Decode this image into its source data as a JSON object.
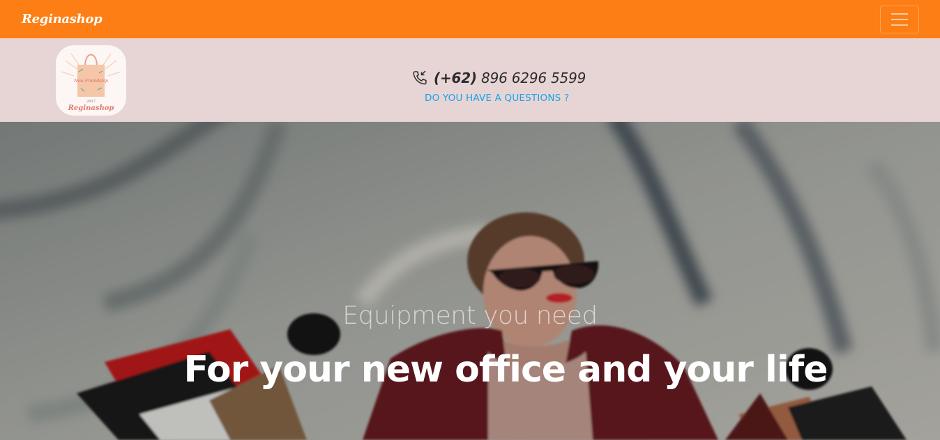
{
  "navbar": {
    "brand": "Reginashop",
    "menu_icon": "hamburger-menu-icon",
    "background_color": "#fd7e14"
  },
  "infobar": {
    "logo": {
      "icon": "shopping-bag-logo",
      "bag_text": "New Friendship",
      "year": "2017",
      "name": "Reginashop"
    },
    "phone_icon": "phone-incoming-icon",
    "phone_code": "(+62)",
    "phone_number": "896 6296 5599",
    "question_link": "DO YOU HAVE A QUESTIONS ?",
    "background_color": "#e7d5d6",
    "link_color": "#17a2e8"
  },
  "hero": {
    "subtitle": "Equipment you need",
    "title": "For your new office and your life"
  }
}
